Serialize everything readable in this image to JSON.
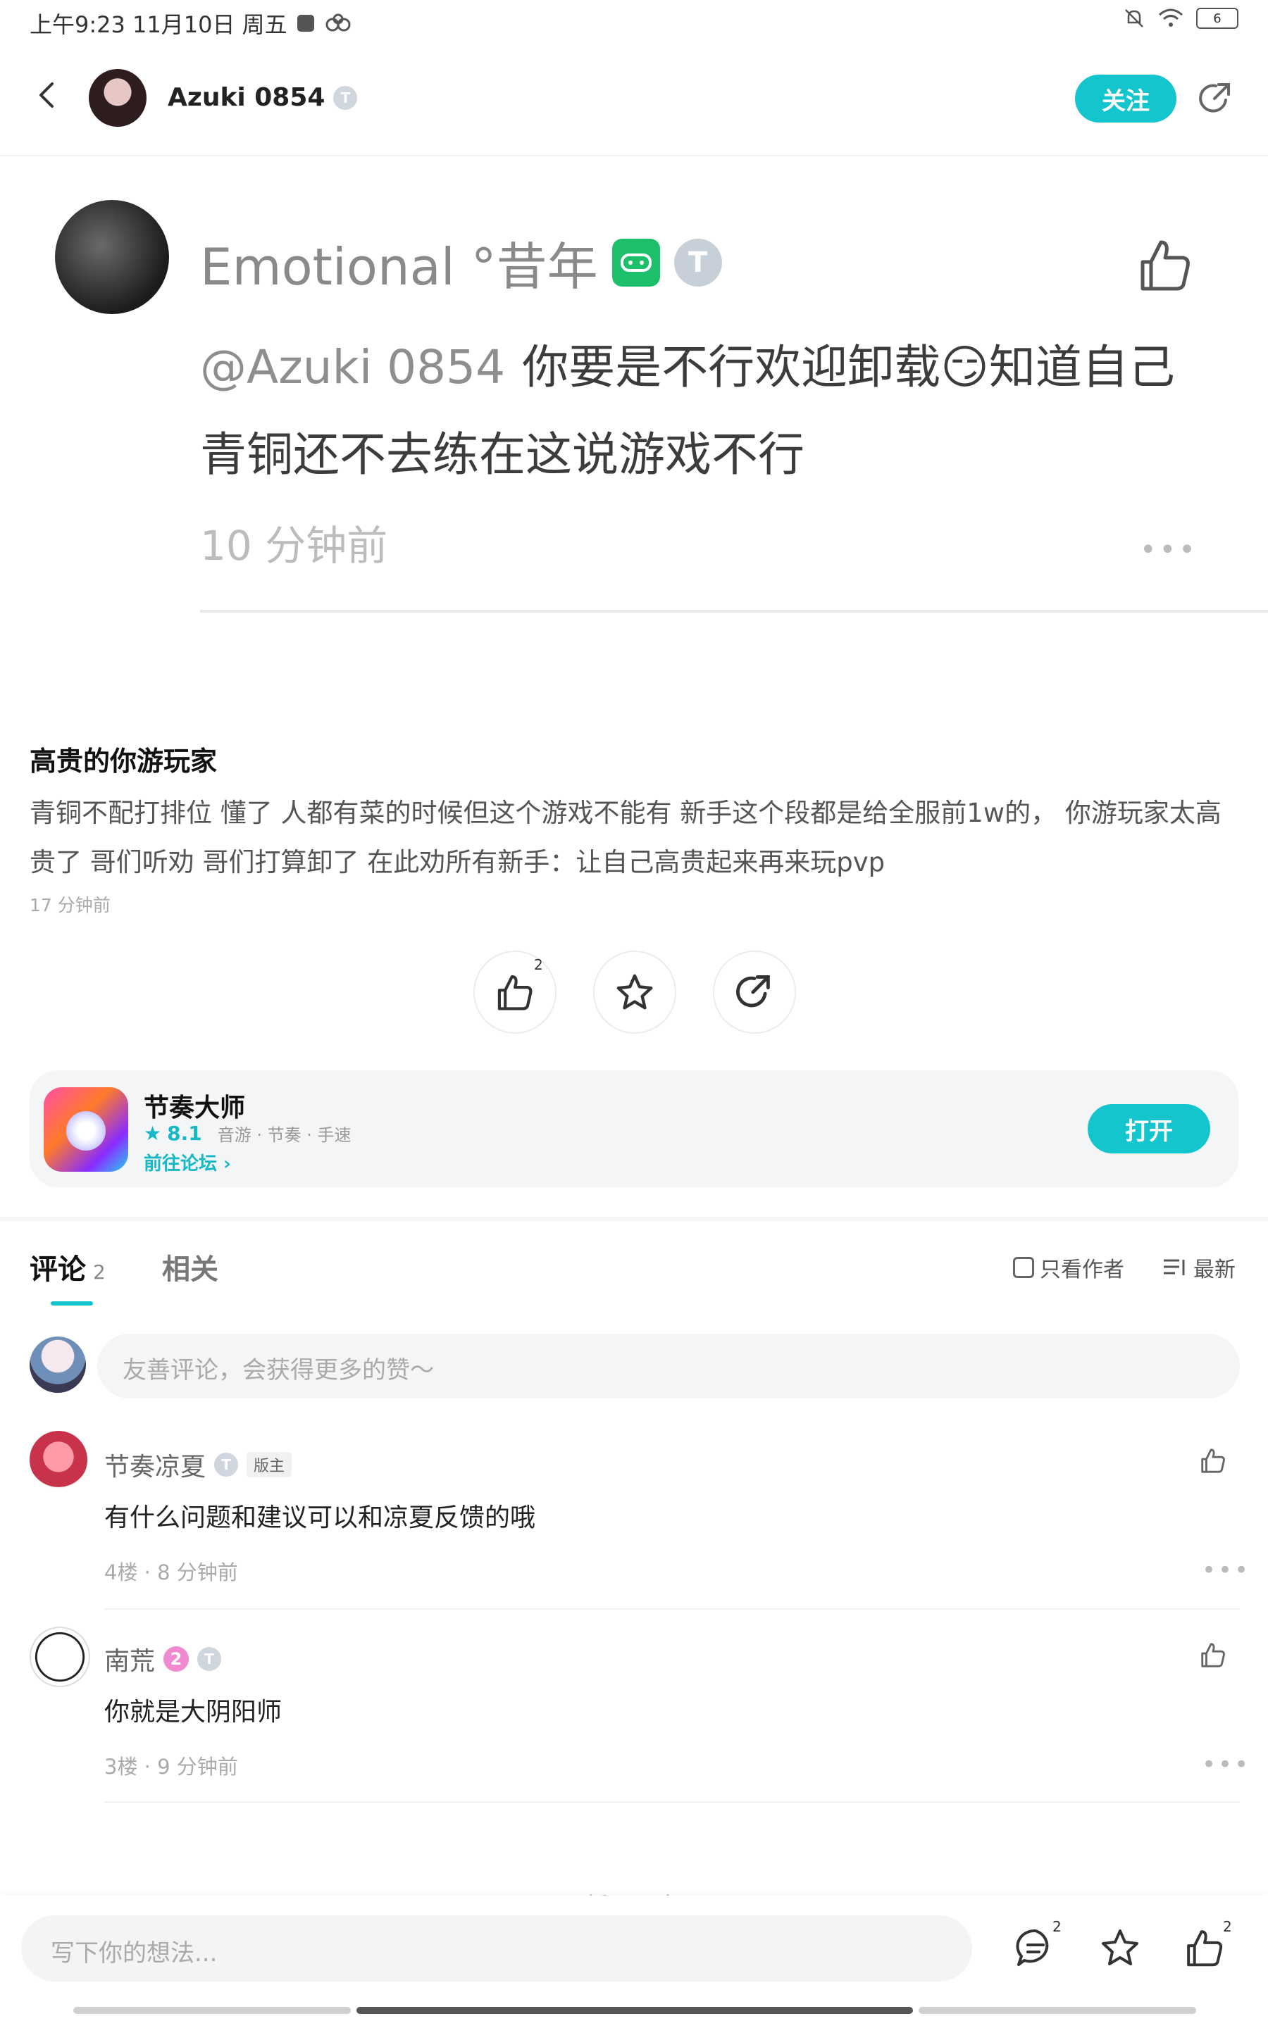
{
  "status_bar": {
    "time": "上午9:23 11月10日 周五",
    "battery": "6"
  },
  "header": {
    "username": "Azuki 0854",
    "badge": "T",
    "follow_label": "关注"
  },
  "quoted_comment": {
    "author": "Emotional °昔年",
    "badge": "T",
    "mention": "@Azuki 0854",
    "text": "你要是不行欢迎卸载😏知道自己青铜还不去练在这说游戏不行",
    "time": "10 分钟前",
    "more": "•••"
  },
  "post": {
    "title": "高贵的你游玩家",
    "body": "青铜不配打排位 懂了 人都有菜的时候但这个游戏不能有 新手这个段都是给全服前1w的， 你游玩家太高贵了 哥们听劝 哥们打算卸了 在此劝所有新手：让自己高贵起来再来玩pvp",
    "time": "17 分钟前",
    "like_count": "2"
  },
  "game_card": {
    "name": "节奏大师",
    "rating": "8.1",
    "tags": "音游 · 节奏 · 手速",
    "forum_link": "前往论坛",
    "open_label": "打开"
  },
  "comments_section": {
    "tab_comment": "评论",
    "comment_count": "2",
    "tab_related": "相关",
    "only_author": "只看作者",
    "sort": "最新",
    "input_placeholder": "友善评论，会获得更多的赞～"
  },
  "comments": [
    {
      "author": "节奏凉夏",
      "badge": "T",
      "role": "版主",
      "text": "有什么问题和建议可以和凉夏反馈的哦",
      "meta": "4楼 · 8 分钟前",
      "more": "•••"
    },
    {
      "author": "南荒",
      "level": "2",
      "badge": "T",
      "text": "你就是大阴阳师",
      "meta": "3楼 · 9 分钟前",
      "more": "•••"
    }
  ],
  "footer_partial": "暂无更多",
  "bottom_bar": {
    "placeholder": "写下你的想法...",
    "comment_count": "2",
    "like_count": "2"
  },
  "colors": {
    "accent": "#15c5ce",
    "badge_green": "#1dbf6b"
  }
}
